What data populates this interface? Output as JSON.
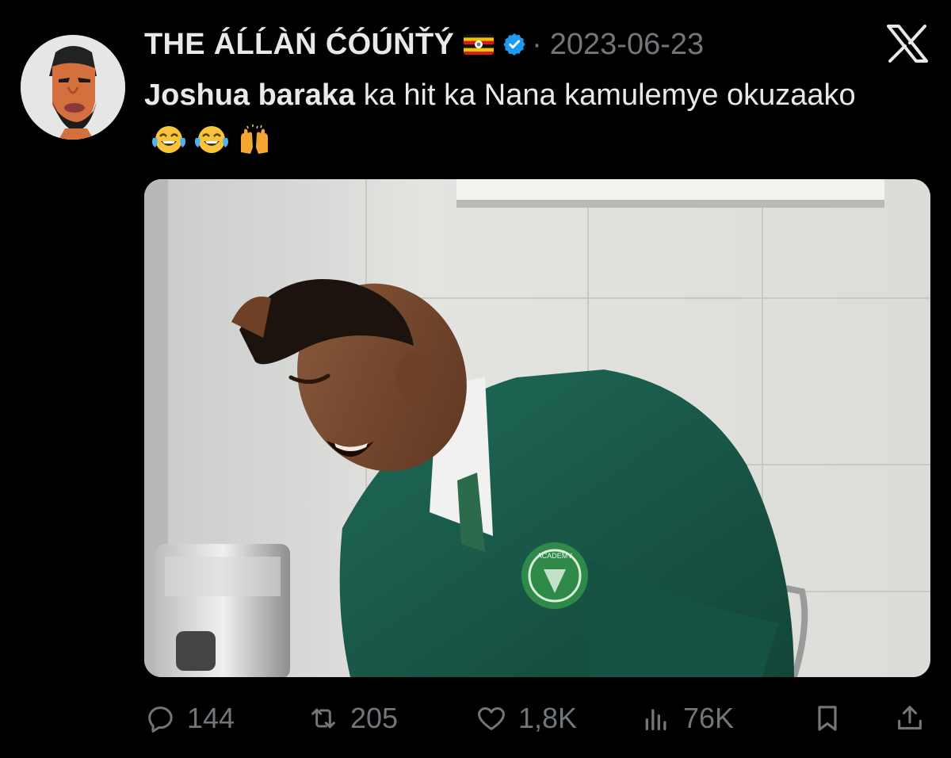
{
  "author": {
    "display_name": "THE ÁĹĹÀŃ ĆÓÚŃŤÝ",
    "flag_icon": "uganda-flag-icon",
    "verified_icon": "verified-badge-icon",
    "separator": "·",
    "date": "2023-06-23"
  },
  "tweet": {
    "bold_text": "Joshua baraka",
    "text": " ka hit ka Nana kamulemye okuzaako",
    "emojis": [
      "tears-of-joy-emoji",
      "tears-of-joy-emoji",
      "raising-hands-emoji"
    ]
  },
  "media": {
    "type": "photo",
    "emblem_text": "ACADEMY"
  },
  "actions": {
    "replies": "144",
    "reposts": "205",
    "likes": "1,8K",
    "views": "76K"
  },
  "colors": {
    "background": "#000000",
    "primary_text": "#e7e9ea",
    "secondary_text": "#71767b",
    "verified": "#1d9bf0"
  }
}
